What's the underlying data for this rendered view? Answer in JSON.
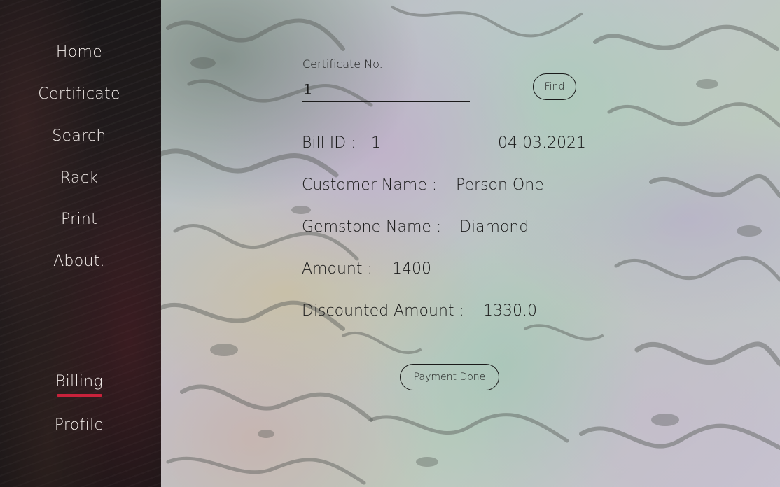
{
  "sidebar": {
    "items": [
      {
        "label": "Home"
      },
      {
        "label": "Certificate"
      },
      {
        "label": "Search"
      },
      {
        "label": "Rack"
      },
      {
        "label": "Print"
      },
      {
        "label": "About."
      },
      {
        "label": "Billing",
        "active": true
      },
      {
        "label": "Profile"
      }
    ],
    "accent_color": "#c8223b"
  },
  "form": {
    "certificate_label": "Certificate No.",
    "certificate_value": "1",
    "find_label": "Find"
  },
  "bill": {
    "bill_id_label": "Bill ID :",
    "bill_id_value": "1",
    "date": "04.03.2021",
    "customer_label": "Customer Name :",
    "customer_value": "Person One",
    "gemstone_label": "Gemstone Name :",
    "gemstone_value": "Diamond",
    "amount_label": "Amount :",
    "amount_value": "1400",
    "discounted_label": "Discounted Amount :",
    "discounted_value": "1330.0"
  },
  "payment_button_label": "Payment Done"
}
